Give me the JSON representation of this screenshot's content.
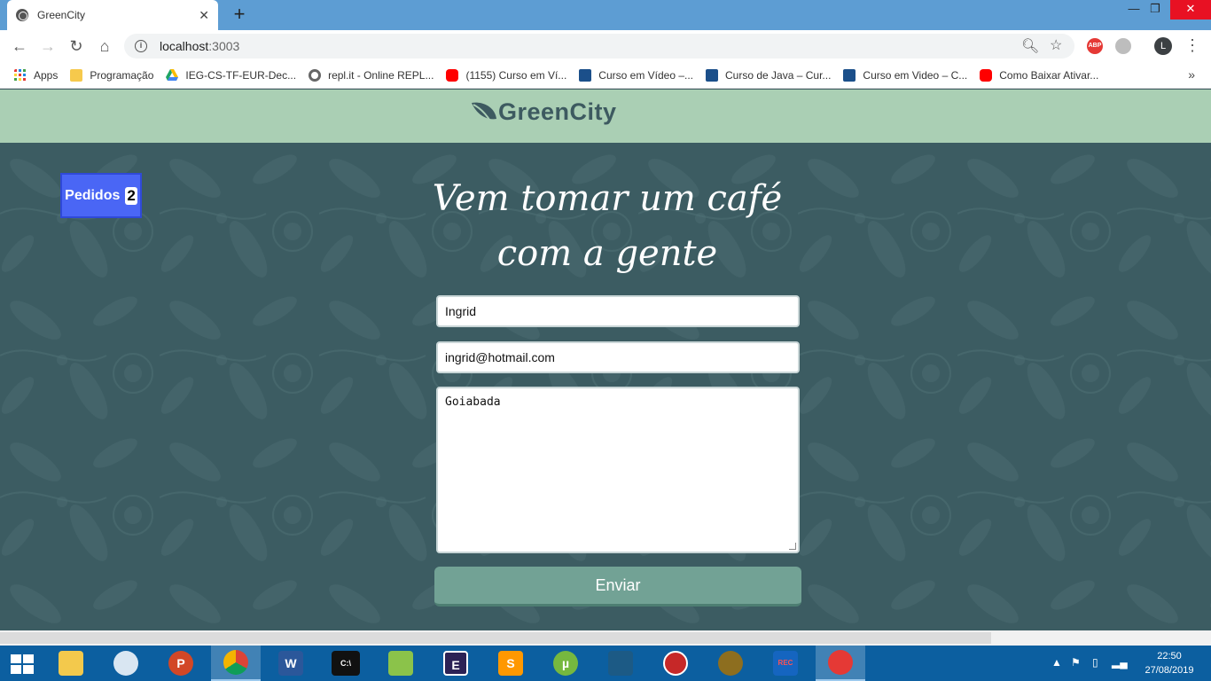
{
  "browser": {
    "tab_title": "GreenCity",
    "url_host": "localhost",
    "url_port": ":3003",
    "new_tab_label": "+",
    "close_tab_label": "✕",
    "window_controls": {
      "minimize": "—",
      "restore": "❐",
      "close": "✕"
    },
    "extensions": {
      "abp_label": "ABP"
    },
    "profile_initial": "L",
    "bookmarks": [
      {
        "label": "Apps",
        "icon": "apps-grid-icon"
      },
      {
        "label": "Programação",
        "icon": "folder-icon"
      },
      {
        "label": "IEG-CS-TF-EUR-Dec...",
        "icon": "google-drive-icon"
      },
      {
        "label": "repl.it - Online REPL...",
        "icon": "replit-icon"
      },
      {
        "label": "(1155) Curso em Ví...",
        "icon": "youtube-icon"
      },
      {
        "label": "Curso em Vídeo –...",
        "icon": "cursoemvideo-icon"
      },
      {
        "label": "Curso de Java – Cur...",
        "icon": "cursoemvideo-icon"
      },
      {
        "label": "Curso em Video – C...",
        "icon": "cursoemvideo-icon"
      },
      {
        "label": "Como Baixar Ativar...",
        "icon": "youtube-icon"
      }
    ],
    "bookmarks_more": "»"
  },
  "site": {
    "brand": "GreenCity",
    "orders_label": "Pedidos",
    "orders_count": "2",
    "headline_line1": "Vem tomar um café",
    "headline_line2": "com a gente",
    "form": {
      "name_value": "Ingrid",
      "email_value": "ingrid@hotmail.com",
      "message_value": "Goiabada",
      "submit_label": "Enviar"
    }
  },
  "taskbar": {
    "apps": [
      {
        "name": "file-explorer",
        "label": ""
      },
      {
        "name": "paint",
        "label": ""
      },
      {
        "name": "powerpoint",
        "label": "P"
      },
      {
        "name": "chrome",
        "label": ""
      },
      {
        "name": "word",
        "label": "W"
      },
      {
        "name": "command-prompt",
        "label": "C:\\"
      },
      {
        "name": "notepad-plus-plus",
        "label": ""
      },
      {
        "name": "eclipse",
        "label": "E"
      },
      {
        "name": "sublime-text",
        "label": "S"
      },
      {
        "name": "utorrent",
        "label": "µ"
      },
      {
        "name": "mysql-workbench",
        "label": ""
      },
      {
        "name": "red-app",
        "label": ""
      },
      {
        "name": "badge-app",
        "label": ""
      },
      {
        "name": "screen-recorder",
        "label": "REC"
      },
      {
        "name": "ccleaner",
        "label": ""
      }
    ],
    "time": "22:50",
    "date": "27/08/2019"
  },
  "colors": {
    "header_bg": "#aacfb4",
    "page_bg": "#3c5c62",
    "orders_bg": "#4a66f5",
    "button_bg": "#72a295",
    "taskbar_bg": "#0c5fa0",
    "tabstrip_bg": "#5d9dd3"
  }
}
